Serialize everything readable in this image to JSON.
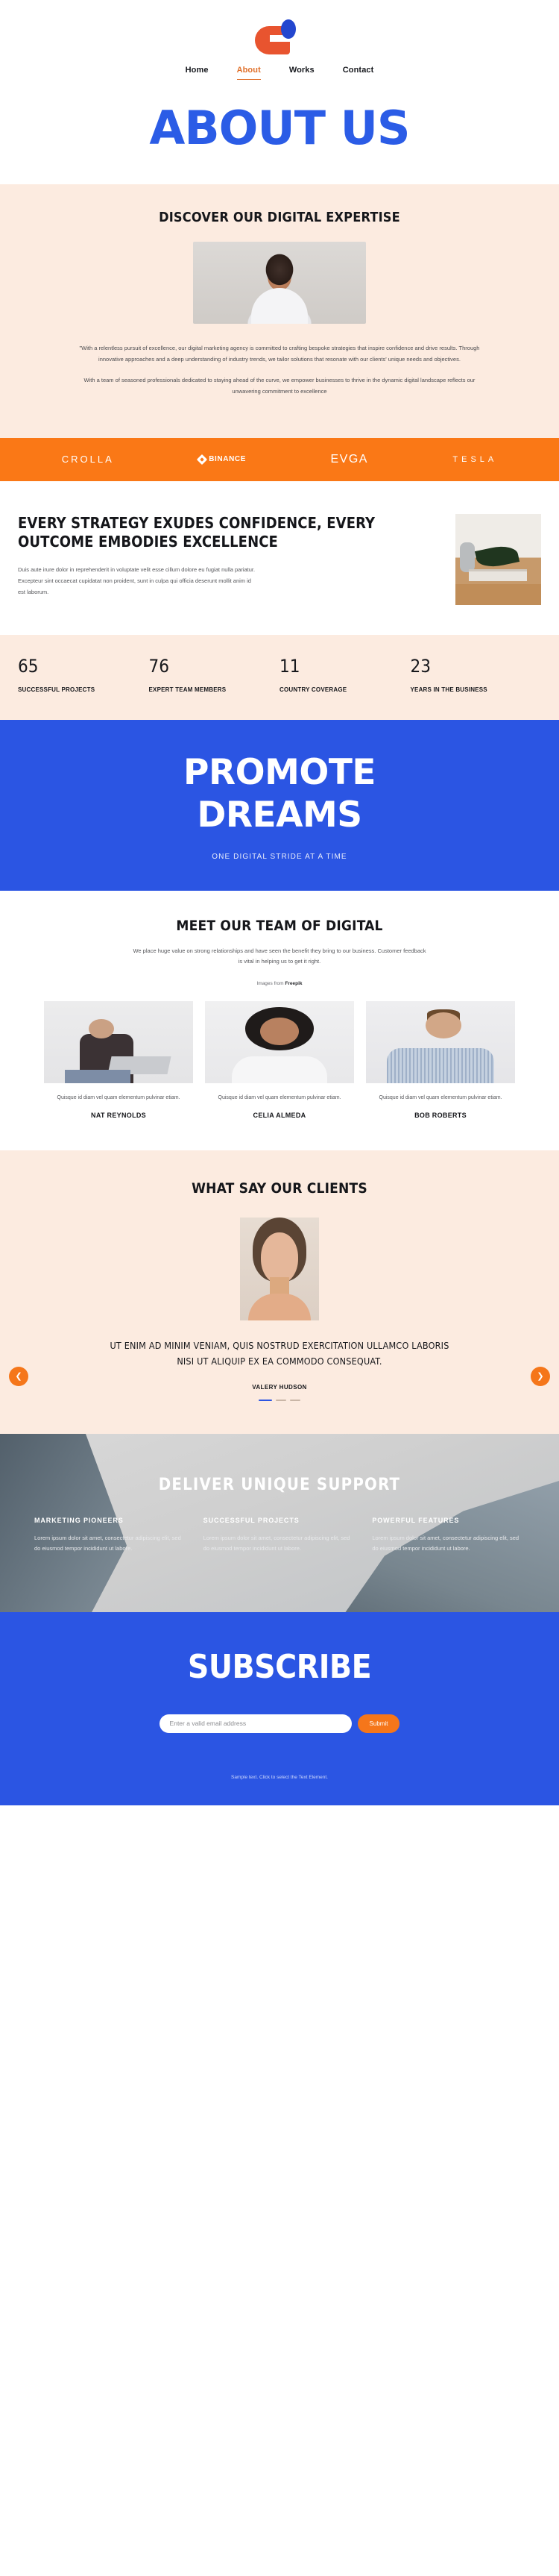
{
  "brand": {
    "logo_name": "brand-logo",
    "accent_orange": "#e8542f",
    "accent_blue": "#2346cf"
  },
  "nav": {
    "items": [
      {
        "label": "Home",
        "active": false
      },
      {
        "label": "About",
        "active": true
      },
      {
        "label": "Works",
        "active": false
      },
      {
        "label": "Contact",
        "active": false
      }
    ]
  },
  "hero": {
    "title": "ABOUT US"
  },
  "discover": {
    "heading": "DISCOVER OUR DIGITAL EXPERTISE",
    "paragraph1": "\"With a relentless pursuit of excellence, our digital marketing agency is committed to crafting bespoke strategies that inspire confidence and drive results. Through innovative approaches and a deep understanding of industry trends, we tailor solutions that resonate with our clients' unique needs and objectives.",
    "paragraph2": "With a team of seasoned professionals dedicated to staying ahead of the curve, we empower businesses to thrive in the dynamic digital landscape reflects our unwavering commitment to excellence"
  },
  "brands": {
    "background": "#fa7816",
    "items": [
      {
        "name": "CROLLA"
      },
      {
        "name": "BINANCE"
      },
      {
        "name": "EVGA"
      },
      {
        "name": "TESLA"
      }
    ]
  },
  "strategy": {
    "heading": "EVERY STRATEGY EXUDES CONFIDENCE, EVERY OUTCOME EMBODIES EXCELLENCE",
    "paragraph": "Duis aute irure dolor in reprehenderit in voluptate velit esse cillum dolore eu fugiat nulla pariatur. Excepteur sint occaecat cupidatat non proident, sunt in culpa qui officia deserunt mollit anim id est laborum."
  },
  "stats": {
    "items": [
      {
        "number": "65",
        "label": "SUCCESSFUL PROJECTS"
      },
      {
        "number": "76",
        "label": "EXPERT TEAM MEMBERS"
      },
      {
        "number": "11",
        "label": "COUNTRY COVERAGE"
      },
      {
        "number": "23",
        "label": "YEARS IN THE BUSINESS"
      }
    ]
  },
  "promote": {
    "line1": "PROMOTE",
    "line2": "DREAMS",
    "subtitle": "ONE DIGITAL STRIDE AT A TIME"
  },
  "team": {
    "heading": "MEET OUR TEAM OF DIGITAL",
    "intro": "We place huge value on strong relationships and have seen the benefit they bring to our business. Customer feedback is vital in helping us to get it right.",
    "credit_prefix": "Images from ",
    "credit_source": "Freepik",
    "members": [
      {
        "caption": "Quisque id diam vel quam elementum pulvinar etiam.",
        "name": "NAT REYNOLDS"
      },
      {
        "caption": "Quisque id diam vel quam elementum pulvinar etiam.",
        "name": "CELIA ALMEDA"
      },
      {
        "caption": "Quisque id diam vel quam elementum pulvinar etiam.",
        "name": "BOB ROBERTS"
      }
    ]
  },
  "testimonials": {
    "heading": "WHAT SAY OUR CLIENTS",
    "quote": "UT ENIM AD MINIM VENIAM, QUIS NOSTRUD EXERCITATION ULLAMCO LABORIS NISI UT ALIQUIP EX EA COMMODO CONSEQUAT.",
    "author": "VALERY HUDSON",
    "prev_icon": "chevron-left-icon",
    "next_icon": "chevron-right-icon"
  },
  "support": {
    "heading": "DELIVER UNIQUE SUPPORT",
    "columns": [
      {
        "title": "MARKETING PIONEERS",
        "text": "Lorem ipsum dolor sit amet, consectetur adipiscing elit, sed do eiusmod tempor incididunt ut labore."
      },
      {
        "title": "SUCCESSFUL PROJECTS",
        "text": "Lorem ipsum dolor sit amet, consectetur adipiscing elit, sed do eiusmod tempor incididunt ut labore."
      },
      {
        "title": "POWERFUL FEATURES",
        "text": "Lorem ipsum dolor sit amet, consectetur adipiscing elit, sed do eiusmod tempor incididunt ut labore."
      }
    ]
  },
  "subscribe": {
    "heading": "SUBSCRIBE",
    "email_placeholder": "Enter a valid email address",
    "email_value": "",
    "submit_label": "Submit",
    "footnote": "Sample text. Click to select the Text Element."
  }
}
